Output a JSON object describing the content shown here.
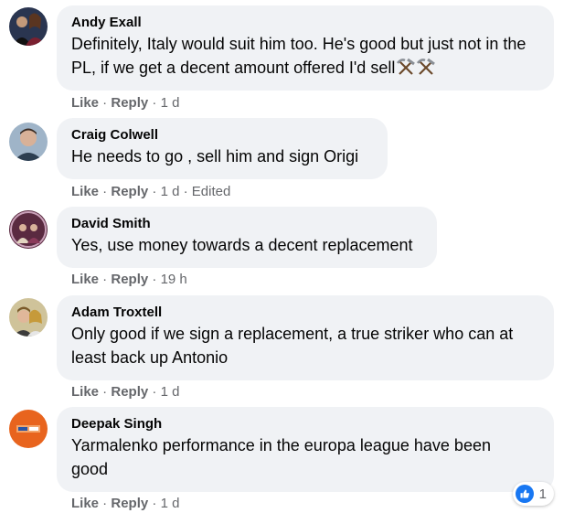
{
  "comments": [
    {
      "author": "Andy Exall",
      "text": "Definitely, Italy would suit him too. He's good but just not in the PL, if we get a decent amount offered I'd sell",
      "emoji_icons": [
        "hammer-and-pick-icon",
        "hammer-and-pick-icon"
      ],
      "actions": {
        "like": "Like",
        "reply": "Reply",
        "time": "1 d"
      }
    },
    {
      "author": "Craig Colwell",
      "text": "He needs to go , sell him and sign Origi",
      "actions": {
        "like": "Like",
        "reply": "Reply",
        "time": "1 d",
        "edited": "Edited"
      }
    },
    {
      "author": "David Smith",
      "text": "Yes, use money towards a decent replacement",
      "actions": {
        "like": "Like",
        "reply": "Reply",
        "time": "19 h"
      }
    },
    {
      "author": "Adam Troxtell",
      "text": "Only good if we sign a replacement, a true striker who can at least back up Antonio",
      "actions": {
        "like": "Like",
        "reply": "Reply",
        "time": "1 d"
      }
    },
    {
      "author": "Deepak Singh",
      "text": "Yarmalenko performance in the europa league have been good",
      "actions": {
        "like": "Like",
        "reply": "Reply",
        "time": "1 d"
      },
      "reactions": {
        "icon": "thumbs-up-icon",
        "count": "1"
      }
    }
  ],
  "colors": {
    "bubble_bg": "#f0f2f5",
    "meta_text": "#65676b",
    "like_blue": "#1877f2"
  }
}
